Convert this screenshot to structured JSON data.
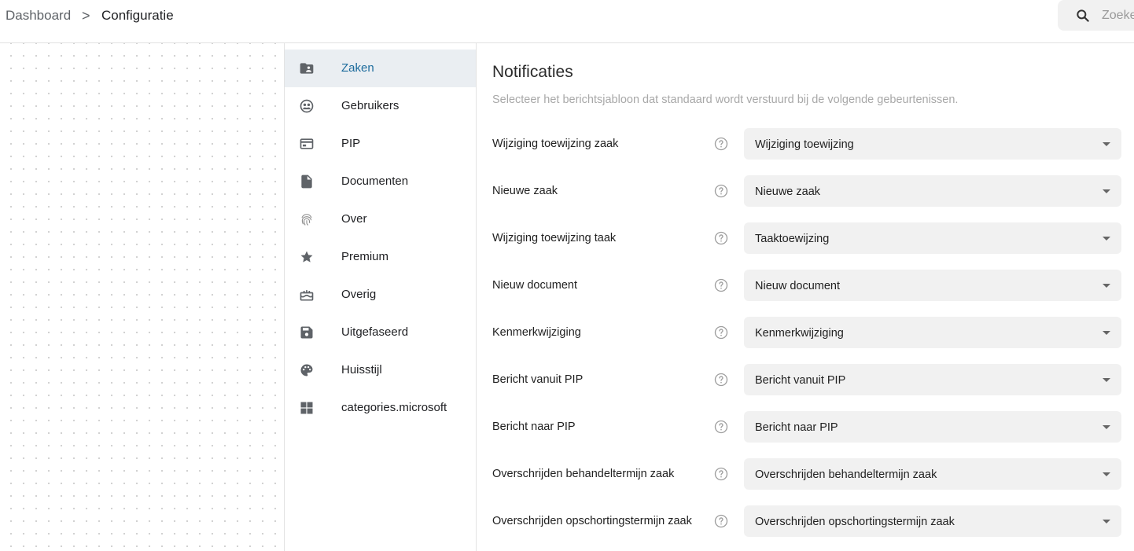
{
  "breadcrumb": {
    "items": [
      "Dashboard",
      "Configuratie"
    ],
    "separator": ">"
  },
  "search": {
    "placeholder": "Zoeken",
    "icon": "search-icon"
  },
  "colors": {
    "accent": "#1c6b9c",
    "active_bg": "#eaeef2",
    "select_bg": "#f1f1f1"
  },
  "sidebar": {
    "active_index": 0,
    "items": [
      {
        "label": "Zaken",
        "icon": "folder-account-icon"
      },
      {
        "label": "Gebruikers",
        "icon": "people-circle-icon"
      },
      {
        "label": "PIP",
        "icon": "web-window-icon"
      },
      {
        "label": "Documenten",
        "icon": "document-icon"
      },
      {
        "label": "Over",
        "icon": "fingerprint-icon"
      },
      {
        "label": "Premium",
        "icon": "star-icon"
      },
      {
        "label": "Overig",
        "icon": "cake-icon"
      },
      {
        "label": "Uitgefaseerd",
        "icon": "save-icon"
      },
      {
        "label": "Huisstijl",
        "icon": "palette-icon"
      },
      {
        "label": "categories.microsoft",
        "icon": "windows-icon"
      }
    ]
  },
  "main": {
    "title": "Notificaties",
    "subtitle": "Selecteer het berichtsjabloon dat standaard wordt verstuurd bij de volgende gebeurtenissen.",
    "rows": [
      {
        "label": "Wijziging toewijzing zaak",
        "value": "Wijziging toewijzing"
      },
      {
        "label": "Nieuwe zaak",
        "value": "Nieuwe zaak"
      },
      {
        "label": "Wijziging toewijzing taak",
        "value": "Taaktoewijzing"
      },
      {
        "label": "Nieuw document",
        "value": "Nieuw document"
      },
      {
        "label": "Kenmerkwijziging",
        "value": "Kenmerkwijziging"
      },
      {
        "label": "Bericht vanuit PIP",
        "value": "Bericht vanuit PIP"
      },
      {
        "label": "Bericht naar PIP",
        "value": "Bericht naar PIP"
      },
      {
        "label": "Overschrijden behandeltermijn zaak",
        "value": "Overschrijden behandeltermijn zaak"
      },
      {
        "label": "Overschrijden opschortingstermijn zaak",
        "value": "Overschrijden opschortingstermijn zaak"
      }
    ]
  }
}
